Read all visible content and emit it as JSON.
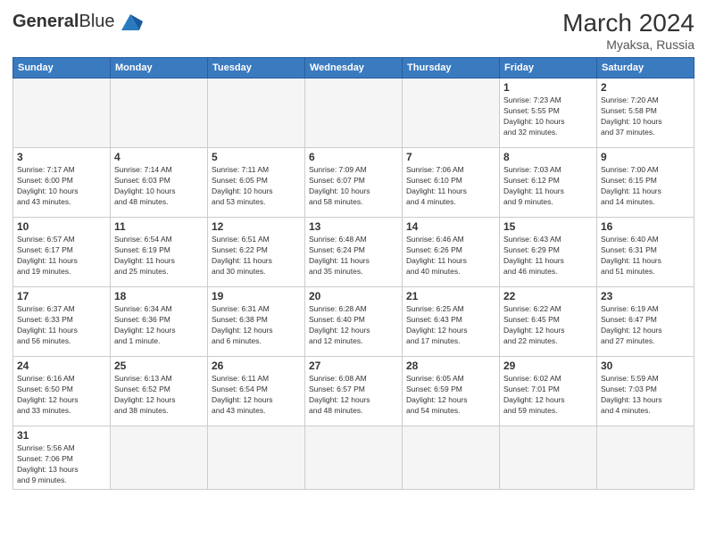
{
  "header": {
    "logo_general": "General",
    "logo_blue": "Blue",
    "month_year": "March 2024",
    "location": "Myaksa, Russia"
  },
  "days_of_week": [
    "Sunday",
    "Monday",
    "Tuesday",
    "Wednesday",
    "Thursday",
    "Friday",
    "Saturday"
  ],
  "weeks": [
    [
      {
        "day": "",
        "info": "",
        "empty": true
      },
      {
        "day": "",
        "info": "",
        "empty": true
      },
      {
        "day": "",
        "info": "",
        "empty": true
      },
      {
        "day": "",
        "info": "",
        "empty": true
      },
      {
        "day": "",
        "info": "",
        "empty": true
      },
      {
        "day": "1",
        "info": "Sunrise: 7:23 AM\nSunset: 5:55 PM\nDaylight: 10 hours\nand 32 minutes."
      },
      {
        "day": "2",
        "info": "Sunrise: 7:20 AM\nSunset: 5:58 PM\nDaylight: 10 hours\nand 37 minutes."
      }
    ],
    [
      {
        "day": "3",
        "info": "Sunrise: 7:17 AM\nSunset: 6:00 PM\nDaylight: 10 hours\nand 43 minutes."
      },
      {
        "day": "4",
        "info": "Sunrise: 7:14 AM\nSunset: 6:03 PM\nDaylight: 10 hours\nand 48 minutes."
      },
      {
        "day": "5",
        "info": "Sunrise: 7:11 AM\nSunset: 6:05 PM\nDaylight: 10 hours\nand 53 minutes."
      },
      {
        "day": "6",
        "info": "Sunrise: 7:09 AM\nSunset: 6:07 PM\nDaylight: 10 hours\nand 58 minutes."
      },
      {
        "day": "7",
        "info": "Sunrise: 7:06 AM\nSunset: 6:10 PM\nDaylight: 11 hours\nand 4 minutes."
      },
      {
        "day": "8",
        "info": "Sunrise: 7:03 AM\nSunset: 6:12 PM\nDaylight: 11 hours\nand 9 minutes."
      },
      {
        "day": "9",
        "info": "Sunrise: 7:00 AM\nSunset: 6:15 PM\nDaylight: 11 hours\nand 14 minutes."
      }
    ],
    [
      {
        "day": "10",
        "info": "Sunrise: 6:57 AM\nSunset: 6:17 PM\nDaylight: 11 hours\nand 19 minutes."
      },
      {
        "day": "11",
        "info": "Sunrise: 6:54 AM\nSunset: 6:19 PM\nDaylight: 11 hours\nand 25 minutes."
      },
      {
        "day": "12",
        "info": "Sunrise: 6:51 AM\nSunset: 6:22 PM\nDaylight: 11 hours\nand 30 minutes."
      },
      {
        "day": "13",
        "info": "Sunrise: 6:48 AM\nSunset: 6:24 PM\nDaylight: 11 hours\nand 35 minutes."
      },
      {
        "day": "14",
        "info": "Sunrise: 6:46 AM\nSunset: 6:26 PM\nDaylight: 11 hours\nand 40 minutes."
      },
      {
        "day": "15",
        "info": "Sunrise: 6:43 AM\nSunset: 6:29 PM\nDaylight: 11 hours\nand 46 minutes."
      },
      {
        "day": "16",
        "info": "Sunrise: 6:40 AM\nSunset: 6:31 PM\nDaylight: 11 hours\nand 51 minutes."
      }
    ],
    [
      {
        "day": "17",
        "info": "Sunrise: 6:37 AM\nSunset: 6:33 PM\nDaylight: 11 hours\nand 56 minutes."
      },
      {
        "day": "18",
        "info": "Sunrise: 6:34 AM\nSunset: 6:36 PM\nDaylight: 12 hours\nand 1 minute."
      },
      {
        "day": "19",
        "info": "Sunrise: 6:31 AM\nSunset: 6:38 PM\nDaylight: 12 hours\nand 6 minutes."
      },
      {
        "day": "20",
        "info": "Sunrise: 6:28 AM\nSunset: 6:40 PM\nDaylight: 12 hours\nand 12 minutes."
      },
      {
        "day": "21",
        "info": "Sunrise: 6:25 AM\nSunset: 6:43 PM\nDaylight: 12 hours\nand 17 minutes."
      },
      {
        "day": "22",
        "info": "Sunrise: 6:22 AM\nSunset: 6:45 PM\nDaylight: 12 hours\nand 22 minutes."
      },
      {
        "day": "23",
        "info": "Sunrise: 6:19 AM\nSunset: 6:47 PM\nDaylight: 12 hours\nand 27 minutes."
      }
    ],
    [
      {
        "day": "24",
        "info": "Sunrise: 6:16 AM\nSunset: 6:50 PM\nDaylight: 12 hours\nand 33 minutes."
      },
      {
        "day": "25",
        "info": "Sunrise: 6:13 AM\nSunset: 6:52 PM\nDaylight: 12 hours\nand 38 minutes."
      },
      {
        "day": "26",
        "info": "Sunrise: 6:11 AM\nSunset: 6:54 PM\nDaylight: 12 hours\nand 43 minutes."
      },
      {
        "day": "27",
        "info": "Sunrise: 6:08 AM\nSunset: 6:57 PM\nDaylight: 12 hours\nand 48 minutes."
      },
      {
        "day": "28",
        "info": "Sunrise: 6:05 AM\nSunset: 6:59 PM\nDaylight: 12 hours\nand 54 minutes."
      },
      {
        "day": "29",
        "info": "Sunrise: 6:02 AM\nSunset: 7:01 PM\nDaylight: 12 hours\nand 59 minutes."
      },
      {
        "day": "30",
        "info": "Sunrise: 5:59 AM\nSunset: 7:03 PM\nDaylight: 13 hours\nand 4 minutes."
      }
    ],
    [
      {
        "day": "31",
        "info": "Sunrise: 5:56 AM\nSunset: 7:06 PM\nDaylight: 13 hours\nand 9 minutes."
      },
      {
        "day": "",
        "info": "",
        "empty": true
      },
      {
        "day": "",
        "info": "",
        "empty": true
      },
      {
        "day": "",
        "info": "",
        "empty": true
      },
      {
        "day": "",
        "info": "",
        "empty": true
      },
      {
        "day": "",
        "info": "",
        "empty": true
      },
      {
        "day": "",
        "info": "",
        "empty": true
      }
    ]
  ]
}
